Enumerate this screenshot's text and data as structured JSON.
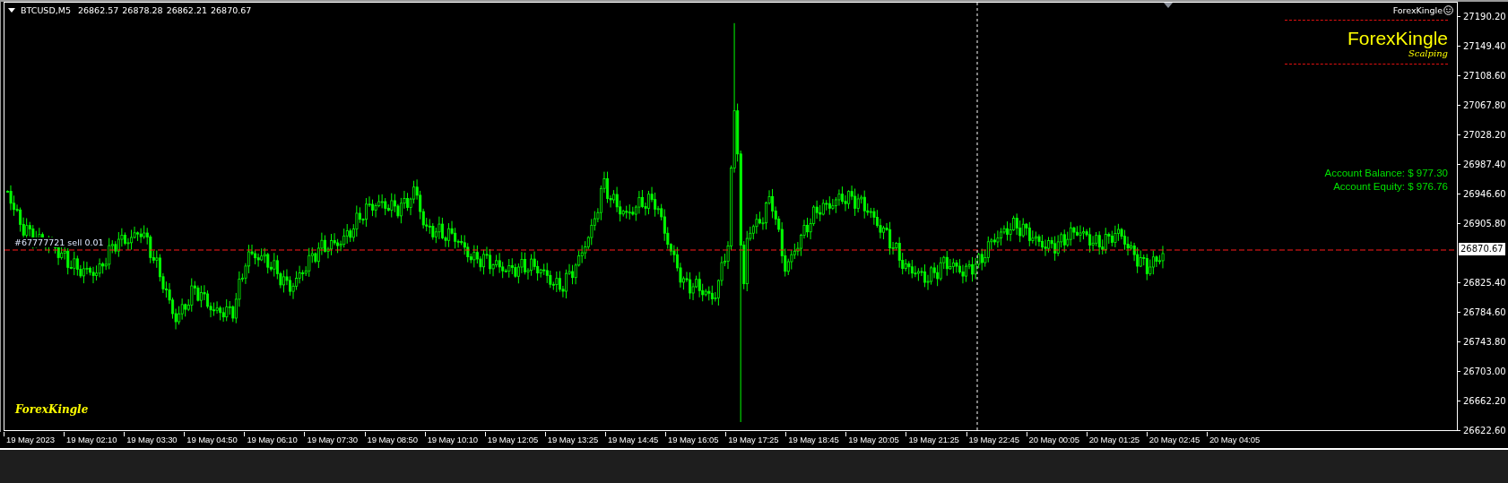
{
  "symbol_header": {
    "symbol": "BTCUSD,M5",
    "open": "26862.57",
    "high": "26878.28",
    "low": "26862.21",
    "close": "26870.67"
  },
  "expert": {
    "name": "ForexKingle"
  },
  "logo": {
    "title": "ForexKingle",
    "subtitle": "Scalping"
  },
  "account": [
    "Account Balance: $ 977.30",
    "Account Equity: $ 976.76"
  ],
  "order_label": "#67777721 sell 0.01",
  "price_line": {
    "label": "26870.67"
  },
  "price_axis": [
    "27190.20",
    "27149.40",
    "27108.60",
    "27067.80",
    "27028.20",
    "26987.40",
    "26946.60",
    "26905.80",
    "26825.40",
    "26784.60",
    "26743.80",
    "26703.00",
    "26662.20",
    "26622.60"
  ],
  "time_axis": [
    "19 May 2023",
    "19 May 02:10",
    "19 May 03:30",
    "19 May 04:50",
    "19 May 06:10",
    "19 May 07:30",
    "19 May 08:50",
    "19 May 10:10",
    "19 May 12:05",
    "19 May 13:25",
    "19 May 14:45",
    "19 May 16:05",
    "19 May 17:25",
    "19 May 18:45",
    "19 May 20:05",
    "19 May 21:25",
    "19 May 22:45",
    "20 May 00:05",
    "20 May 01:25",
    "20 May 02:45",
    "20 May 04:05"
  ],
  "corner_logo": "ForexKingle"
}
